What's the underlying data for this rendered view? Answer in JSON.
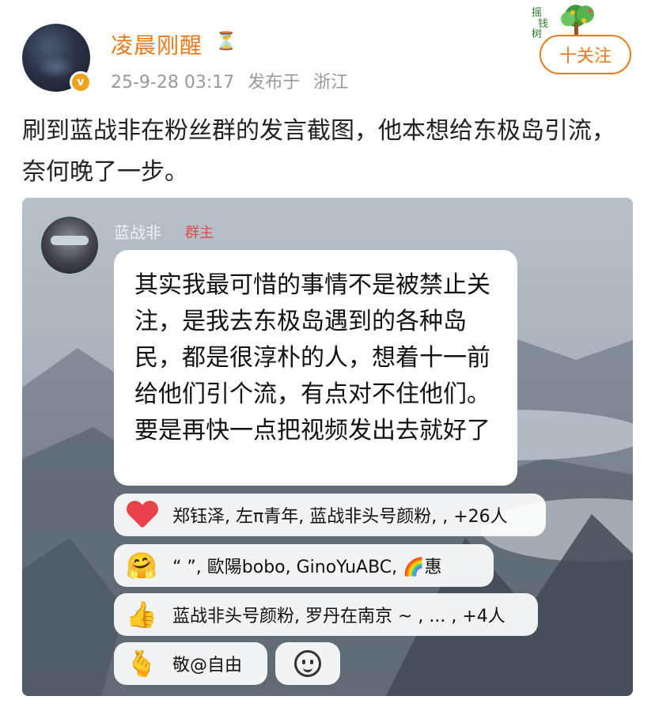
{
  "post": {
    "author": "凌晨刚醒",
    "badge_icon": "hourglass-icon",
    "timestamp": "25-9-28 03:17",
    "published_label": "发布于",
    "location": "浙江",
    "follow_label": "十关注",
    "text": "刷到蓝战非在粉丝群的发言截图，他本想给东极岛引流，奈何晚了一步。"
  },
  "screenshot": {
    "sender_name": "蓝战非",
    "sender_role": "群主",
    "message": "其实我最可惜的事情不是被禁止关注，是我去东极岛遇到的各种岛民，都是很淳朴的人，想着十一前给他们引个流，有点对不住他们。要是再快一点把视频发出去就好了",
    "reactions": [
      {
        "icon": "red-heart-icon",
        "text": "郑钰泽, 左π青年, 蓝战非头号颜粉, , +26人"
      },
      {
        "icon": "hugging-face-icon",
        "text": "“ ”, 歐陽bobo, GinoYuABC, 🌈惠"
      },
      {
        "icon": "thumbs-up-icon",
        "text": "蓝战非头号颜粉, 罗丹在南京 ~ , ... , +4人"
      },
      {
        "icon": "finger-heart-icon",
        "text": "敬@自由"
      }
    ],
    "add_reaction_icon": "smiley-icon"
  },
  "colors": {
    "username": "#e8791b",
    "follow_border": "#e8791b",
    "role_tag": "#e24b4b",
    "heart": "#e8434a"
  }
}
